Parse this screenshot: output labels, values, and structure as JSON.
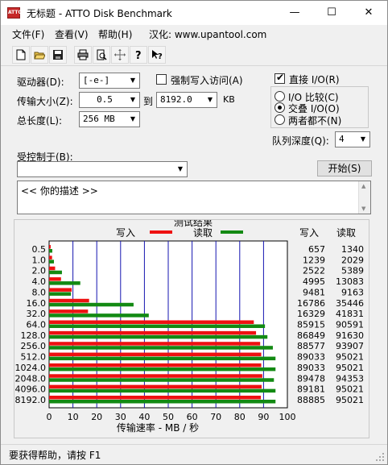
{
  "window": {
    "title": "无标题 - ATTO Disk Benchmark",
    "icon_text": "ATTO",
    "controls": [
      "—",
      "☐",
      "✕"
    ]
  },
  "menu": {
    "items": [
      "文件(F)",
      "查看(V)",
      "帮助(H)",
      "汉化: www.upantool.com"
    ]
  },
  "toolbar": {
    "icons": [
      "new-file-icon",
      "open-folder-icon",
      "save-icon",
      "print-icon",
      "print-preview-icon",
      "move-icon",
      "help-icon",
      "context-help-icon"
    ]
  },
  "form": {
    "drive_label": "驱动器(D):",
    "drive_value": "[-e-]",
    "force_write_label": "强制写入访问(A)",
    "force_write_checked": false,
    "transfer_label": "传输大小(Z):",
    "transfer_from": "0.5",
    "to_label": "到",
    "transfer_to": "8192.0",
    "unit": "KB",
    "length_label": "总长度(L):",
    "length_value": "256 MB",
    "direct_io_label": "直接 I/O(R)",
    "direct_io_checked": true,
    "io_options": [
      "I/O 比较(C)",
      "交叠 I/O(O)",
      "两者都不(N)"
    ],
    "io_selected": 1,
    "queue_label": "队列深度(Q):",
    "queue_value": "4",
    "controlled_label": "受控制于(B):",
    "controlled_value": "",
    "start_button": "开始(S)",
    "description": "<<   你的描述    >>"
  },
  "results": {
    "title": "测试结果",
    "legend_write": "写入",
    "legend_read": "读取",
    "col_write": "写入",
    "col_read": "读取",
    "xlabel": "传输速率 - MB / 秒",
    "write_color": "#ee1111",
    "read_color": "#138a13",
    "grid_color": "#1515b0"
  },
  "chart_data": {
    "type": "bar",
    "categories": [
      "0.5",
      "1.0",
      "2.0",
      "4.0",
      "8.0",
      "16.0",
      "32.0",
      "64.0",
      "128.0",
      "256.0",
      "512.0",
      "1024.0",
      "2048.0",
      "4096.0",
      "8192.0"
    ],
    "series": [
      {
        "name": "写入",
        "values": [
          657,
          1239,
          2522,
          4995,
          9481,
          16786,
          16329,
          85915,
          86849,
          88577,
          89033,
          89033,
          89478,
          89181,
          88885
        ]
      },
      {
        "name": "读取",
        "values": [
          1340,
          2029,
          5389,
          13083,
          9163,
          35446,
          41831,
          90591,
          91630,
          93907,
          95021,
          95021,
          94353,
          95021,
          95021
        ]
      }
    ],
    "xticks": [
      "0",
      "10",
      "20",
      "30",
      "40",
      "50",
      "60",
      "70",
      "80",
      "90",
      "100"
    ],
    "xlim": [
      0,
      100
    ],
    "xlabel": "传输速率 - MB / 秒",
    "unit_scale": 1000
  },
  "status": {
    "text": "要获得帮助，请按 F1"
  }
}
